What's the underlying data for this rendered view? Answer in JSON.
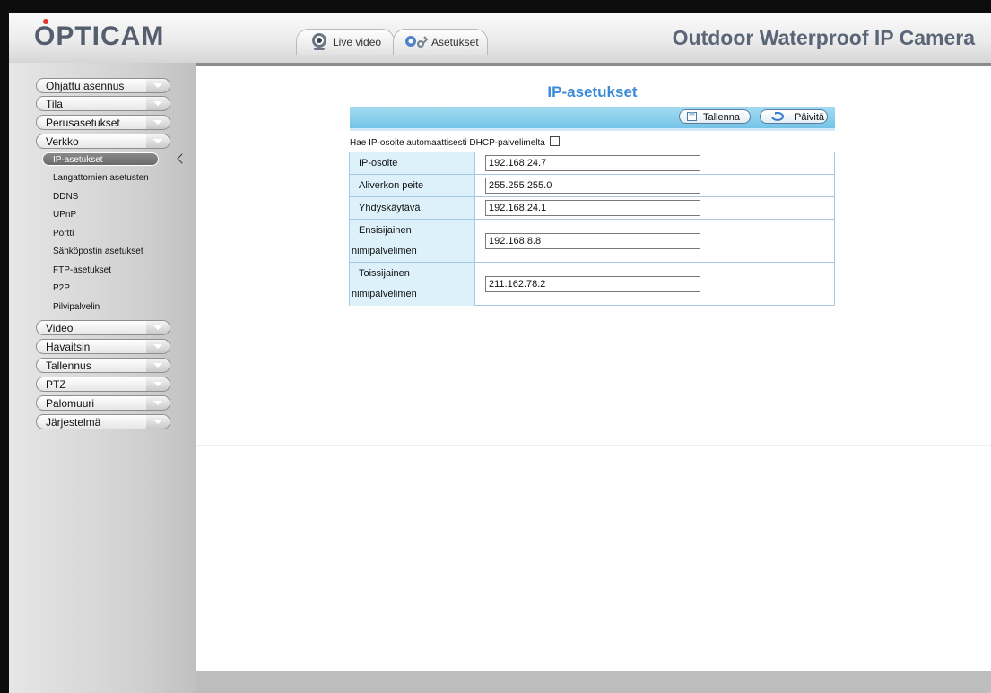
{
  "header": {
    "logo": "OPTICAM",
    "title": "Outdoor Waterproof IP Camera",
    "tabs": [
      {
        "label": "Live video",
        "icon": "webcam-icon"
      },
      {
        "label": "Asetukset",
        "icon": "gears-icon"
      }
    ]
  },
  "sidebar": {
    "menu": [
      {
        "label": "Ohjattu asennus"
      },
      {
        "label": "Tila"
      },
      {
        "label": "Perusasetukset"
      },
      {
        "label": "Verkko"
      },
      {
        "label": "Video"
      },
      {
        "label": "Havaitsin"
      },
      {
        "label": "Tallennus"
      },
      {
        "label": "PTZ"
      },
      {
        "label": "Palomuuri"
      },
      {
        "label": "Järjestelmä"
      }
    ],
    "network_submenu": [
      {
        "label": "IP-asetukset",
        "active": true
      },
      {
        "label": "Langattomien asetusten"
      },
      {
        "label": "DDNS"
      },
      {
        "label": "UPnP"
      },
      {
        "label": "Portti"
      },
      {
        "label": "Sähköpostin asetukset"
      },
      {
        "label": "FTP-asetukset"
      },
      {
        "label": "P2P"
      },
      {
        "label": "Pilvipalvelin"
      }
    ]
  },
  "main": {
    "title": "IP-asetukset",
    "toolbar": {
      "save_label": "Tallenna",
      "refresh_label": "Päivitä"
    },
    "dhcp_label": "Hae IP-osoite automaattisesti DHCP-palvelimelta",
    "dhcp_checked": false,
    "fields": [
      {
        "label": "IP-osoite",
        "value": "192.168.24.7"
      },
      {
        "label": "Aliverkon peite",
        "value": "255.255.255.0"
      },
      {
        "label": "Yhdyskäytävä",
        "value": "192.168.24.1"
      },
      {
        "label_line1": "Ensisijainen",
        "label_line2": "nimipalvelimen",
        "value": "192.168.8.8"
      },
      {
        "label_line1": "Toissijainen",
        "label_line2": "nimipalvelimen",
        "value": "211.162.78.2"
      }
    ]
  },
  "colors": {
    "accent": "#3b8bd9",
    "toolbar": "#8fd0ee",
    "label_bg": "#ddf1fb"
  }
}
